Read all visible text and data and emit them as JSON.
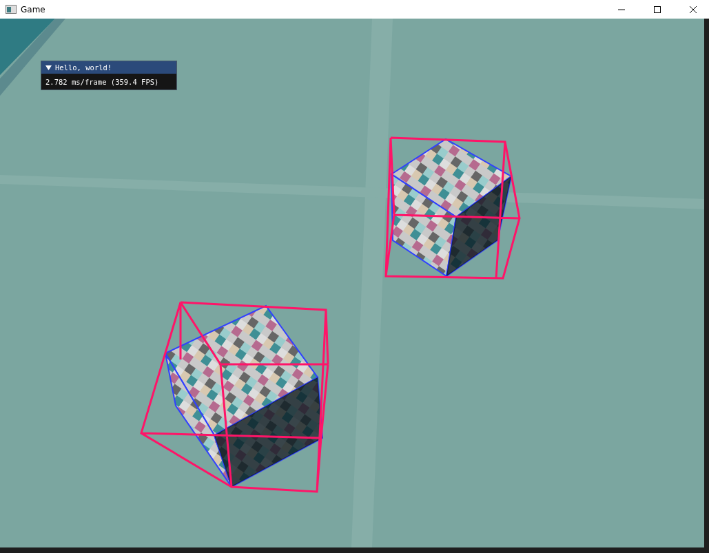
{
  "window": {
    "title": "Game"
  },
  "overlay": {
    "title": "Hello, world!",
    "expanded": true,
    "stats": "2.782 ms/frame (359.4 FPS)"
  }
}
